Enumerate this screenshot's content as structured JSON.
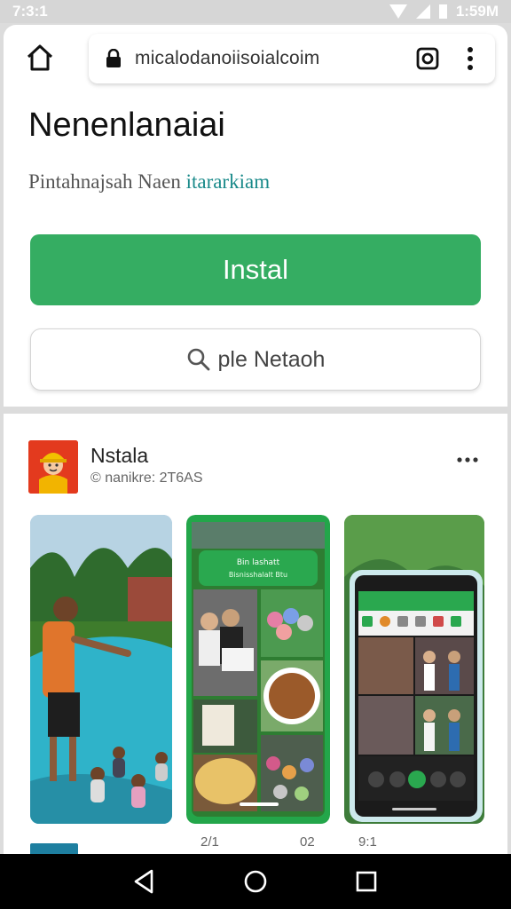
{
  "status": {
    "time": "7:3:1",
    "battery": "1:59M"
  },
  "browser": {
    "url": "micalodanoiisoialcoim"
  },
  "page": {
    "title": "Nenenlanaiai",
    "subtitle_plain": "Pintahnajsah Naen",
    "subtitle_link": "itararkiam",
    "install_label": "Instal",
    "search_label": "ple Netaoh"
  },
  "app": {
    "name": "Nstala",
    "meta": "© nanikre: 2T6AS"
  },
  "shots": {
    "s2_title": "Bin lashatt",
    "s2_sub": "Bisnisshalalt Btu"
  },
  "captions": {
    "c1": "2/1",
    "c2": "02",
    "c3": "9:1"
  },
  "colors": {
    "accent": "#35ad62",
    "link": "#1a8a8a",
    "app_icon_bg": "#e33a1e"
  },
  "icons": [
    "home-icon",
    "lock-icon",
    "tab-switcher-icon",
    "more-vert-icon",
    "search-icon",
    "more-horiz-icon",
    "nav-back-icon",
    "nav-home-icon",
    "nav-recents-icon"
  ]
}
